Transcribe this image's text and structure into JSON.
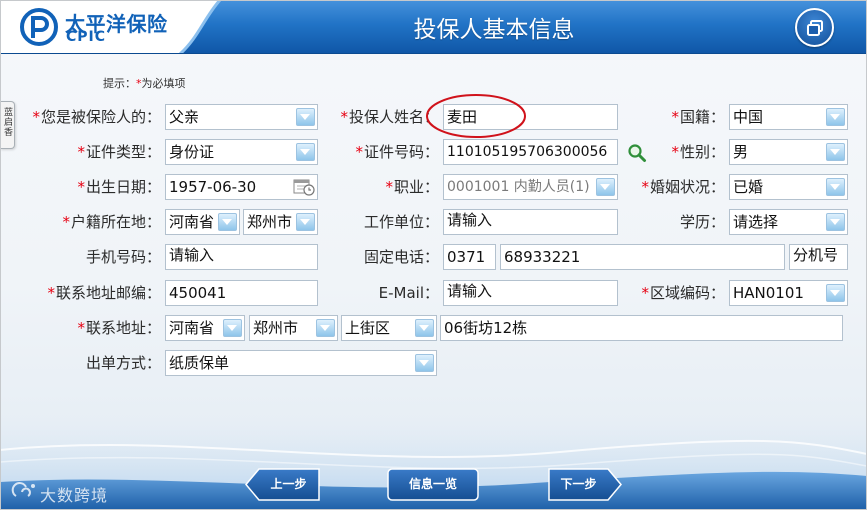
{
  "header": {
    "logo_icon": "cpic-logo-icon",
    "logo_name_cn": "太平洋保险",
    "logo_name_en": "CPIC",
    "title": "投保人基本信息",
    "restore_icon": "window-restore-icon"
  },
  "side_tab": {
    "label": "蓝启香"
  },
  "hint": {
    "prefix": "提示：",
    "mark": "*",
    "text": "为必填项"
  },
  "required_mark": "*",
  "icons": {
    "dropdown": "chevron-down-icon",
    "calendar": "calendar-icon",
    "search": "search-icon"
  },
  "form": {
    "relation": {
      "label": "您是被保险人的：",
      "required": true,
      "value": "父亲"
    },
    "applicant_name": {
      "label": "投保人姓名：",
      "required": true,
      "value": "麦田"
    },
    "nationality": {
      "label": "国籍：",
      "required": true,
      "value": "中国"
    },
    "id_type": {
      "label": "证件类型：",
      "required": true,
      "value": "身份证"
    },
    "id_number": {
      "label": "证件号码：",
      "required": true,
      "value": "110105195706300056"
    },
    "gender": {
      "label": "性别：",
      "required": true,
      "value": "男"
    },
    "birth_date": {
      "label": "出生日期：",
      "required": true,
      "value": "1957-06-30"
    },
    "occupation": {
      "label": "职业：",
      "required": true,
      "value": "0001001 内勤人员(1)"
    },
    "marital_status": {
      "label": "婚姻状况：",
      "required": true,
      "value": "已婚"
    },
    "household": {
      "label": "户籍所在地：",
      "required": true,
      "province": "河南省",
      "city": "郑州市"
    },
    "employer": {
      "label": "工作单位：",
      "required": false,
      "placeholder": "请输入"
    },
    "education": {
      "label": "学历：",
      "required": false,
      "value": "请选择"
    },
    "mobile": {
      "label": "手机号码：",
      "required": false,
      "placeholder": "请输入"
    },
    "landline": {
      "label": "固定电话：",
      "required": false,
      "area_code": "0371",
      "number": "68933221",
      "extension_placeholder": "分机号"
    },
    "postcode": {
      "label": "联系地址邮编：",
      "required": true,
      "value": "450041"
    },
    "email": {
      "label": "E-Mail：",
      "required": false,
      "placeholder": "请输入"
    },
    "region_code": {
      "label": "区域编码：",
      "required": true,
      "value": "HAN0101"
    },
    "address": {
      "label": "联系地址：",
      "required": true,
      "province": "河南省",
      "city": "郑州市",
      "district": "上街区",
      "street": "06街坊12栋"
    },
    "delivery_method": {
      "label": "出单方式：",
      "required": false,
      "value": "纸质保单"
    }
  },
  "footer": {
    "prev_label": "上一步",
    "overview_label": "信息一览",
    "next_label": "下一步"
  },
  "watermark": {
    "text": "大数跨境"
  },
  "colors": {
    "brand_blue": "#1162b8",
    "header_blue": "#1d6cc2",
    "required_red": "#e60012",
    "annotation_red": "#d0121b",
    "button_blue": "#1a5aa3",
    "disabled_text": "#7a7a7a"
  }
}
